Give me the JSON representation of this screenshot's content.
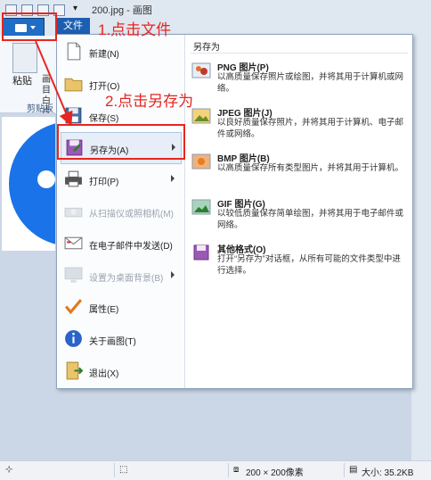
{
  "window": {
    "title": "200.jpg - 画图"
  },
  "file_tab": {
    "label": "文件"
  },
  "ribbon": {
    "paste_label": "粘贴",
    "clipboard_label": "剪贴板",
    "side_chars": "画\n目\n白\n片"
  },
  "menu": {
    "items": [
      {
        "label": "新建(N)",
        "icon": "new-file-icon",
        "disabled": false,
        "submenu": false
      },
      {
        "label": "打开(O)",
        "icon": "open-folder-icon",
        "disabled": false,
        "submenu": false
      },
      {
        "label": "保存(S)",
        "icon": "save-disk-icon",
        "disabled": false,
        "submenu": false
      },
      {
        "label": "另存为(A)",
        "icon": "save-as-icon",
        "disabled": false,
        "submenu": true,
        "highlighted": true
      },
      {
        "label": "打印(P)",
        "icon": "printer-icon",
        "disabled": false,
        "submenu": true
      },
      {
        "label": "从扫描仪或照相机(M)",
        "icon": "scanner-icon",
        "disabled": true,
        "submenu": false
      },
      {
        "label": "在电子邮件中发送(D)",
        "icon": "email-icon",
        "disabled": false,
        "submenu": false
      },
      {
        "label": "设置为桌面背景(B)",
        "icon": "desktop-icon",
        "disabled": true,
        "submenu": true
      },
      {
        "label": "属性(E)",
        "icon": "checkmark-icon",
        "disabled": false,
        "submenu": false
      },
      {
        "label": "关于画图(T)",
        "icon": "info-icon",
        "disabled": false,
        "submenu": false
      },
      {
        "label": "退出(X)",
        "icon": "exit-icon",
        "disabled": false,
        "submenu": false
      }
    ]
  },
  "save_as_panel": {
    "title": "另存为",
    "formats": [
      {
        "name": "PNG 图片(P)",
        "desc": "以高质量保存照片或绘图，并将其用于计算机或网络。",
        "icon": "png-image-icon"
      },
      {
        "name": "JPEG 图片(J)",
        "desc": "以良好质量保存照片，并将其用于计算机、电子邮件或网络。",
        "icon": "jpeg-image-icon"
      },
      {
        "name": "BMP 图片(B)",
        "desc": "以高质量保存所有类型图片，并将其用于计算机。",
        "icon": "bmp-image-icon"
      },
      {
        "name": "GIF 图片(G)",
        "desc": "以较低质量保存简单绘图，并将其用于电子邮件或网络。",
        "icon": "gif-image-icon"
      },
      {
        "name": "其他格式(O)",
        "desc": "打开“另存为”对话框，从所有可能的文件类型中进行选择。",
        "icon": "other-formats-icon"
      }
    ]
  },
  "status": {
    "dimensions": "200 × 200像素",
    "size": "大小: 35.2KB"
  },
  "annotations": {
    "step1": "1.点击文件",
    "step2": "2.点击另存为"
  },
  "colors": {
    "accent": "#1c5fb0",
    "annotation": "#e8251e"
  }
}
